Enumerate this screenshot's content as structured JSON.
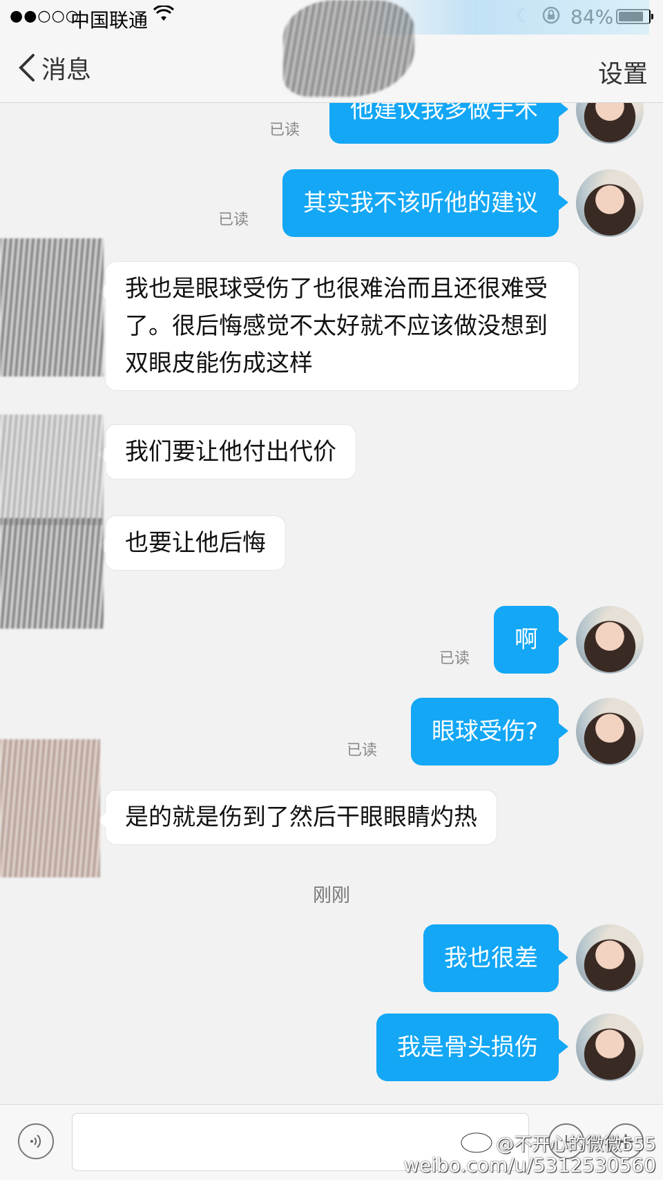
{
  "status_bar": {
    "signal": "●●○○○",
    "carrier": "中国联通",
    "wifi_icon": "wifi-icon",
    "moon_icon": "moon-icon",
    "lock_icon": "rotation-lock-icon",
    "battery_text": "84%",
    "battery_level": 0.84
  },
  "nav": {
    "back_label": "消息",
    "settings_label": "设置"
  },
  "chat": {
    "messages": [
      {
        "side": "out",
        "text": "他建议我多做手术",
        "read": "已读"
      },
      {
        "side": "out",
        "text": "其实我不该听他的建议",
        "read": "已读"
      },
      {
        "side": "in",
        "text": "我也是眼球受伤了也很难治而且还很难受了。很后悔感觉不太好就不应该做没想到双眼皮能伤成这样"
      },
      {
        "side": "in",
        "text": "我们要让他付出代价"
      },
      {
        "side": "in",
        "text": "也要让他后悔"
      },
      {
        "side": "out",
        "text": "啊",
        "read": "已读"
      },
      {
        "side": "out",
        "text": "眼球受伤?",
        "read": "已读"
      },
      {
        "side": "in",
        "text": "是的就是伤到了然后干眼眼睛灼热"
      },
      {
        "side": "out",
        "text": "我也很差"
      },
      {
        "side": "out",
        "text": "我是骨头损伤"
      }
    ],
    "time_separator": "刚刚"
  },
  "input_bar": {
    "value": "",
    "placeholder": "",
    "voice_icon": "voice-icon",
    "emoji_icon": "emoji-icon",
    "plus_icon": "plus-icon"
  },
  "watermark": {
    "line1": "@不开心的微微555",
    "line2": "weibo.com/u/5312530560"
  },
  "colors": {
    "outgoing_bubble": "#13a7f5",
    "incoming_bubble": "#ffffff",
    "background": "#f2f2f2"
  }
}
